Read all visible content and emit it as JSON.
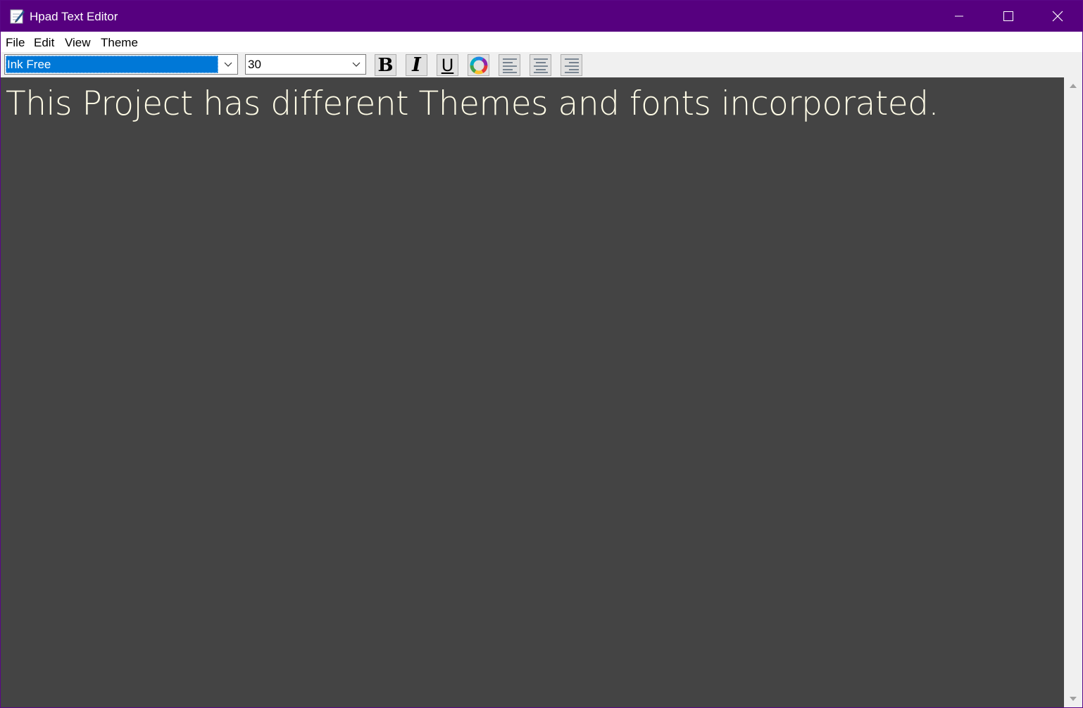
{
  "window": {
    "title": "Hpad Text Editor",
    "title_bar_color": "#56007f",
    "icons": [
      "app-icon",
      "minimize-icon",
      "maximize-icon",
      "close-icon"
    ]
  },
  "menu": {
    "items": [
      "File",
      "Edit",
      "View",
      "Theme"
    ]
  },
  "toolbar": {
    "font": {
      "selected": "Ink Free"
    },
    "size": {
      "selected": "30"
    },
    "buttons": {
      "bold": "B",
      "italic": "I",
      "underline": "U",
      "color_icon": "color-wheel-icon",
      "align_left_icon": "align-left-icon",
      "align_center_icon": "align-center-icon",
      "align_right_icon": "align-right-icon"
    }
  },
  "editor": {
    "content": "This Project has different Themes and fonts incorporated.",
    "background_color": "#444444",
    "text_color": "#fffce6"
  },
  "scrollbar": {
    "icons": [
      "scroll-up-arrow-icon",
      "scroll-down-arrow-icon"
    ]
  }
}
